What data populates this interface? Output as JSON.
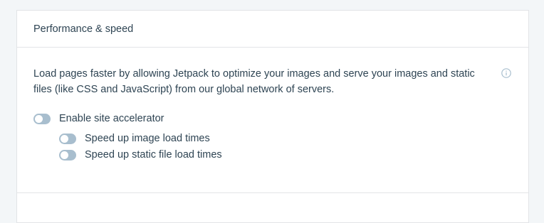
{
  "card": {
    "title": "Performance & speed",
    "description": "Load pages faster by allowing Jetpack to optimize your images and serve your images and static files (like CSS and JavaScript) from our global network of servers.",
    "info_icon": "info-icon"
  },
  "toggles": {
    "site_accelerator": {
      "label": "Enable site accelerator",
      "checked": false
    },
    "image_speedup": {
      "label": "Speed up image load times",
      "checked": false
    },
    "static_speedup": {
      "label": "Speed up static file load times",
      "checked": false
    }
  },
  "colors": {
    "toggle_off": "#a8bece",
    "text": "#2e4453",
    "border": "#e2e4e7",
    "background": "#f3f6f8",
    "card": "#ffffff"
  }
}
